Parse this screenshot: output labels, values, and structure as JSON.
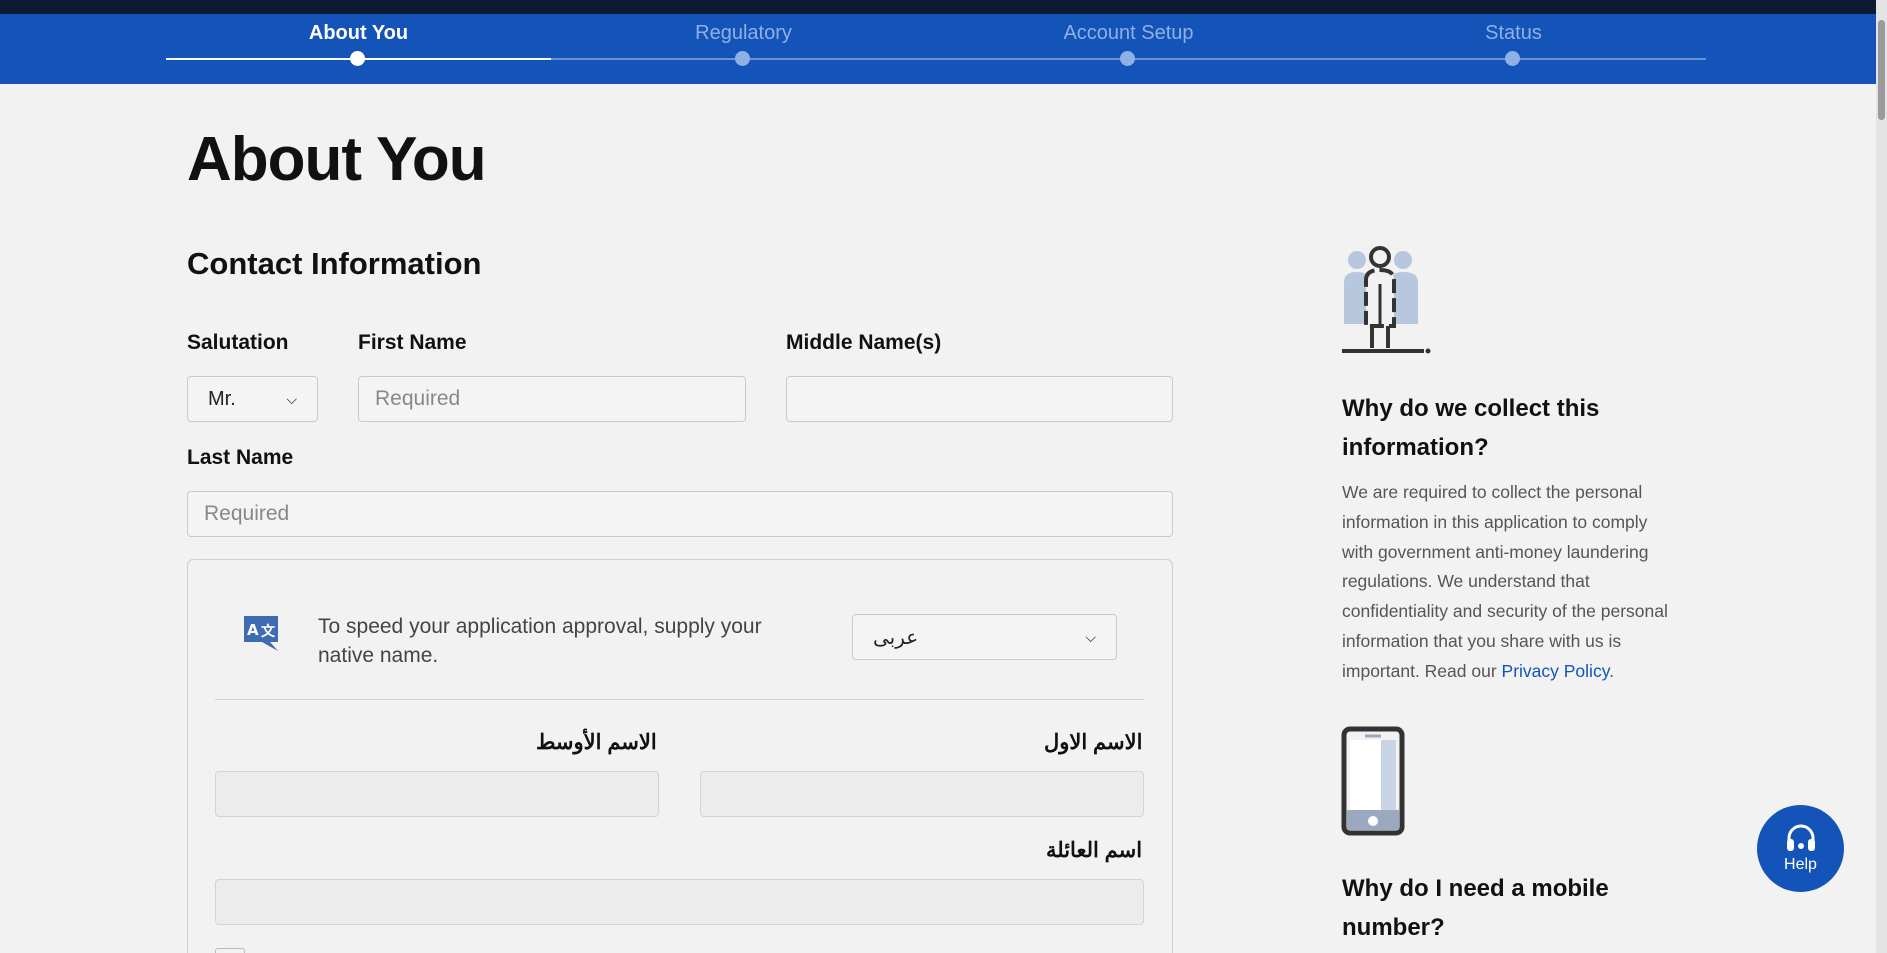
{
  "stepper": {
    "steps": [
      {
        "label": "About You",
        "active": true
      },
      {
        "label": "Regulatory",
        "active": false
      },
      {
        "label": "Account Setup",
        "active": false
      },
      {
        "label": "Status",
        "active": false
      }
    ]
  },
  "page": {
    "title": "About You",
    "section_title": "Contact Information"
  },
  "form": {
    "salutation": {
      "label": "Salutation",
      "value": "Mr."
    },
    "first_name": {
      "label": "First Name",
      "placeholder": "Required"
    },
    "middle_name": {
      "label": "Middle Name(s)",
      "placeholder": ""
    },
    "last_name": {
      "label": "Last Name",
      "placeholder": "Required"
    }
  },
  "native_name": {
    "prompt": "To speed your application approval, supply your native name.",
    "language_value": "عربى",
    "first_name_label": "الاسم الاول",
    "middle_name_label": "الاسم الأوسط",
    "family_name_label": "اسم العائلة"
  },
  "sidebar": {
    "collect_heading": "Why do we collect this information?",
    "collect_text": "We are required to collect the personal information in this application to comply with government anti-money laundering regulations. We understand that confidentiality and security of the personal information that you share with us is important. Read our ",
    "privacy_link": "Privacy Policy",
    "collect_text_end": ".",
    "mobile_heading": "Why do I need a mobile number?"
  },
  "help": {
    "label": "Help"
  },
  "colors": {
    "brand_blue": "#1454b8",
    "top_strip": "#0d1a33",
    "background": "#f2f2f2"
  },
  "icons": [
    "person-group-icon",
    "translate-icon",
    "mobile-phone-icon",
    "headset-icon",
    "chevron-down-icon"
  ]
}
